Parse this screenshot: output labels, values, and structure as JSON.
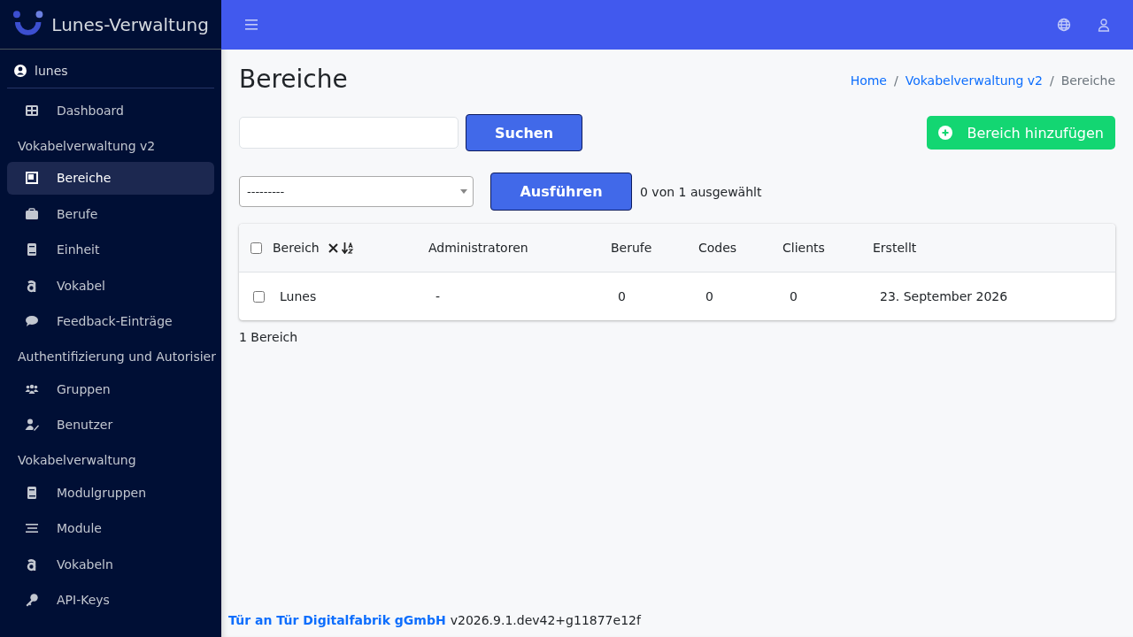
{
  "sidebar": {
    "brand": "Lunes-Verwaltung",
    "user": "lunes",
    "items": [
      {
        "kind": "link",
        "label": "Dashboard",
        "selected": false
      },
      {
        "kind": "heading",
        "label": "Vokabelverwaltung v2"
      },
      {
        "kind": "link",
        "label": "Bereiche",
        "selected": true
      },
      {
        "kind": "link",
        "label": "Berufe",
        "selected": false
      },
      {
        "kind": "link",
        "label": "Einheit",
        "selected": false
      },
      {
        "kind": "link",
        "label": "Vokabel",
        "selected": false
      },
      {
        "kind": "link",
        "label": "Feedback-Einträge",
        "selected": false
      },
      {
        "kind": "heading",
        "label": "Authentifizierung und Autorisier"
      },
      {
        "kind": "link",
        "label": "Gruppen",
        "selected": false
      },
      {
        "kind": "link",
        "label": "Benutzer",
        "selected": false
      },
      {
        "kind": "heading",
        "label": "Vokabelverwaltung"
      },
      {
        "kind": "link",
        "label": "Modulgruppen",
        "selected": false
      },
      {
        "kind": "link",
        "label": "Module",
        "selected": false
      },
      {
        "kind": "link",
        "label": "Vokabeln",
        "selected": false
      },
      {
        "kind": "link",
        "label": "API-Keys",
        "selected": false
      }
    ]
  },
  "page": {
    "title": "Bereiche",
    "breadcrumb": [
      "Home",
      "Vokabelverwaltung v2",
      "Bereiche"
    ],
    "breadcrumb_separator": "/"
  },
  "search": {
    "button": "Suchen"
  },
  "add_button": "Bereich hinzufügen",
  "actions": {
    "select": "---------",
    "button": "Ausführen",
    "counter": "0 von 1 ausgewählt"
  },
  "table": {
    "select_all_checked": false,
    "columns": [
      "Bereich",
      "Administratoren",
      "Berufe",
      "Codes",
      "Clients",
      "Erstellt"
    ],
    "rows": [
      {
        "checked": false,
        "cells": [
          "Lunes",
          "-",
          "0",
          "0",
          "0",
          "23. September 2026"
        ]
      }
    ]
  },
  "result_count": "1 Bereich",
  "footer": {
    "company": "Tür an Tür Digitalfabrik gGmbH",
    "version": "v2026.9.1.dev42+g11877e12f"
  }
}
